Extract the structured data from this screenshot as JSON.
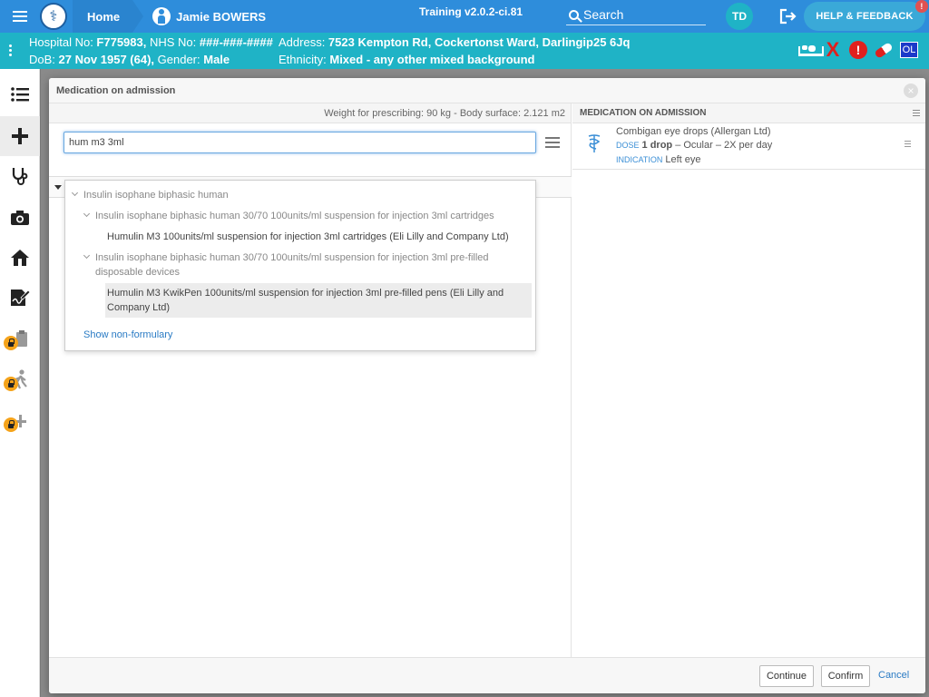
{
  "topbar": {
    "home_label": "Home",
    "patient_label": "Jamie BOWERS",
    "version": "Training v2.0.2-ci.81",
    "search_label": "Search",
    "user_initials": "TD",
    "help_label": "HELP & FEEDBACK",
    "help_badge": "!"
  },
  "banner": {
    "hospital_label": "Hospital No: ",
    "hospital_value": "F775983,",
    "nhs_label": " NHS No: ",
    "nhs_value": "###-###-####",
    "address_label": "Address: ",
    "address_value": "7523 Kempton Rd, Cockertonst Ward, Darlingip25 6Jq",
    "dob_label": "DoB: ",
    "dob_value": "27 Nov 1957 (64),",
    "gender_label": " Gender: ",
    "gender_value": "Male",
    "ethnicity_label": "Ethnicity: ",
    "ethnicity_value": "Mixed - any other mixed background",
    "icons": [
      "bed-icon",
      "x-icon",
      "alert-icon",
      "pill-icon",
      "ol-icon"
    ],
    "ol_label": "OL",
    "x_label": "X",
    "alert_label": "!"
  },
  "leftnav": {
    "items": [
      "list-icon",
      "plus-icon",
      "stethoscope-icon",
      "camera-icon",
      "home-icon",
      "signature-icon",
      "clipboard-icon",
      "walking-icon",
      "add-icon"
    ]
  },
  "modal": {
    "title": "Medication on admission",
    "weight_text": "Weight for prescribing: 90 kg - Body surface: 2.121 m2",
    "search_value": "hum m3 3ml",
    "dropdown": {
      "item1": "Insulin isophane biphasic human",
      "item2": "Insulin isophane biphasic human 30/70 100units/ml suspension for injection 3ml cartridges",
      "item3": "Humulin M3 100units/ml suspension for injection 3ml cartridges (Eli Lilly and Company Ltd)",
      "item4_line1": "Insulin isophane biphasic human 30/70 100units/ml suspension for injection 3ml pre-filled",
      "item4_line2": "disposable devices",
      "item5_line1": "Humulin M3 KwikPen 100units/ml suspension for injection 3ml pre-filled pens (Eli Lilly and",
      "item5_line2": "Company Ltd)",
      "show_nonformulary": "Show non-formulary"
    },
    "right_header": "MEDICATION ON ADMISSION",
    "medication": {
      "name": "Combigan eye drops (Allergan Ltd)",
      "dose_tag": "DOSE",
      "dose_value": "1 drop",
      "dose_rest": " – Ocular – 2X per day",
      "indication_tag": "INDICATION",
      "indication_value": "Left eye"
    },
    "footer": {
      "continue": "Continue",
      "confirm": "Confirm",
      "cancel": "Cancel"
    }
  }
}
